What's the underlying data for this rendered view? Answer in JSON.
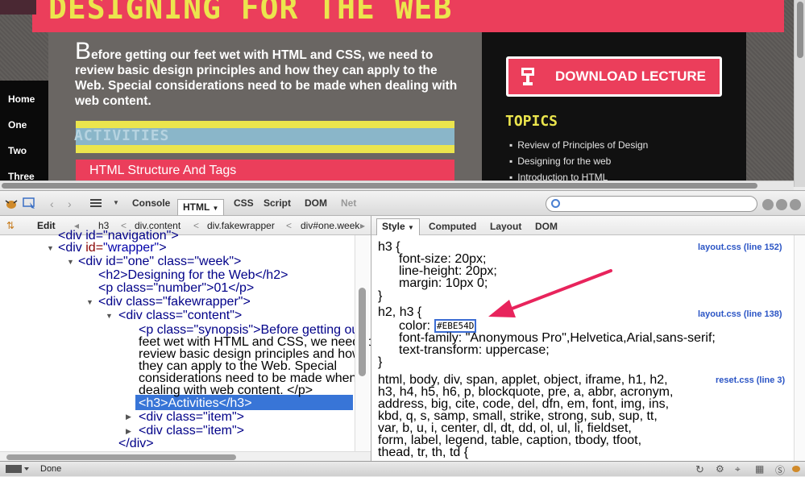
{
  "webpage": {
    "banner_title": "DESIGNING FOR THE WEB",
    "nav": [
      "Home",
      "One",
      "Two",
      "Three"
    ],
    "synopsis_dropcap": "B",
    "synopsis_rest": "efore getting our feet wet with HTML and CSS, we need to review basic design principles and how they can apply to the Web. Special considerations need to be made when dealing with web content.",
    "activities_heading": "ACTIVITIES",
    "item_heading": "HTML Structure And Tags",
    "download_button": "DOWNLOAD LECTURE",
    "topics_title": "TOPICS",
    "topics": [
      "Review of Principles of Design",
      "Designing for the web",
      "Introduction to HTML"
    ]
  },
  "colors": {
    "brand_pink": "#eb3e5b",
    "brand_yellow": "#ebe54d",
    "activities_blue": "#8ab6c9",
    "selection_blue": "#3875d7",
    "arrow_pink": "#e8245c"
  },
  "firebug": {
    "tabs": [
      "Console",
      "HTML",
      "CSS",
      "Script",
      "DOM",
      "Net"
    ],
    "crumbs": {
      "edit": "Edit",
      "items": [
        "h3",
        "div.content",
        "div.fakewrapper",
        "div#one.week"
      ]
    },
    "right_tabs": [
      "Style",
      "Computed",
      "Layout",
      "DOM"
    ],
    "html_lines": {
      "l0": "<div id=\"navigation\">",
      "l1_tag": "<div",
      "l1_attr": " id=",
      "l1_val": "\"wrapper\"",
      "l2": "<div id=\"one\" class=\"week\">",
      "l3": "<h2>Designing for the Web</h2>",
      "l4": "<p class=\"number\">01</p>",
      "l5": "<div class=\"fakewrapper\">",
      "l6": "<div class=\"content\">",
      "l7": "<p class=\"synopsis\">Before getting our",
      "l8": "feet wet with HTML and CSS, we need to",
      "l9": "review basic design principles and how",
      "l10": "they can apply to the Web. Special",
      "l11": "considerations need to be made when",
      "l12": "dealing with web content. </p>",
      "l13": "<h3>Activities</h3>",
      "l14": "<div class=\"item\">",
      "l15": "<div class=\"item\">",
      "l16": "</div>"
    },
    "style_rules": {
      "r1_selector": "h3 {",
      "r1_src": "layout.css (line 152)",
      "r1_p1": "font-size: 20px;",
      "r1_p2": "line-height: 20px;",
      "r1_p3": "margin: 10px 0;",
      "close": "}",
      "r2_selector": "h2, h3 {",
      "r2_src": "layout.css (line 138)",
      "r2_color_prop": "color:",
      "r2_color_val": "#EBE54D",
      "r2_p2": "font-family: \"Anonymous Pro\",Helvetica,Arial,sans-serif;",
      "r2_p3": "text-transform: uppercase;",
      "r3_src": "reset.css (line 3)",
      "r3_l1": "html, body, div, span, applet, object, iframe, h1, h2,",
      "r3_l2": "h3, h4, h5, h6, p, blockquote, pre, a, abbr, acronym,",
      "r3_l3": "address, big, cite, code, del, dfn, em, font, img, ins,",
      "r3_l4": "kbd, q, s, samp, small, strike, strong, sub, sup, tt,",
      "r3_l5": "var, b, u, i, center, dl, dt, dd, ol, ul, li, fieldset,",
      "r3_l6": "form, label, legend, table, caption, tbody, tfoot,",
      "r3_l7": "thead, tr, th, td {"
    }
  },
  "status": "Done"
}
